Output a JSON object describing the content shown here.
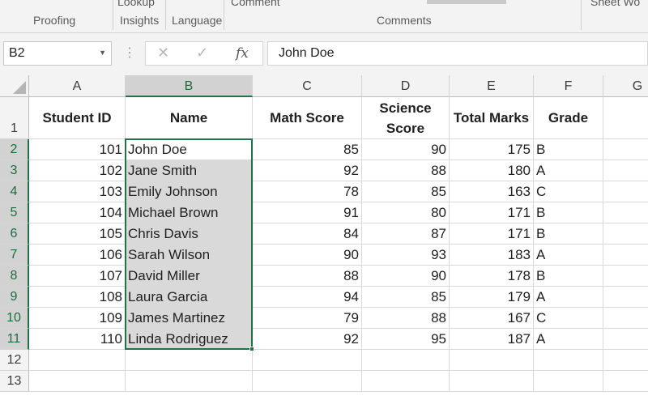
{
  "ribbon": {
    "groups": [
      "Proofing",
      "Insights",
      "Language",
      "Comments"
    ],
    "buttons": [
      "Lookup",
      "Comment",
      "Sheet Wo"
    ]
  },
  "formula_bar": {
    "name_box": "B2",
    "formula": "John Doe",
    "fx_icon": "fx"
  },
  "columns": [
    "A",
    "B",
    "C",
    "D",
    "E",
    "F",
    "G"
  ],
  "rows": [
    "1",
    "2",
    "3",
    "4",
    "5",
    "6",
    "7",
    "8",
    "9",
    "10",
    "11",
    "12",
    "13"
  ],
  "headers": [
    "Student ID",
    "Name",
    "Math Score",
    "Science Score",
    "Total Marks",
    "Grade"
  ],
  "records": [
    [
      "101",
      "John Doe",
      "85",
      "90",
      "175",
      "B"
    ],
    [
      "102",
      "Jane Smith",
      "92",
      "88",
      "180",
      "A"
    ],
    [
      "103",
      "Emily Johnson",
      "78",
      "85",
      "163",
      "C"
    ],
    [
      "104",
      "Michael Brown",
      "91",
      "80",
      "171",
      "B"
    ],
    [
      "105",
      "Chris Davis",
      "84",
      "87",
      "171",
      "B"
    ],
    [
      "106",
      "Sarah Wilson",
      "90",
      "93",
      "183",
      "A"
    ],
    [
      "107",
      "David Miller",
      "88",
      "90",
      "178",
      "B"
    ],
    [
      "108",
      "Laura Garcia",
      "94",
      "85",
      "179",
      "A"
    ],
    [
      "109",
      "James Martinez",
      "79",
      "88",
      "167",
      "C"
    ],
    [
      "110",
      "Linda Rodriguez",
      "92",
      "95",
      "187",
      "A"
    ]
  ],
  "selection": {
    "active_cell": "B2",
    "range": "B2:B11",
    "selected_column": "B",
    "selected_rows": [
      "2",
      "3",
      "4",
      "5",
      "6",
      "7",
      "8",
      "9",
      "10",
      "11"
    ]
  },
  "colors": {
    "accent": "#217346",
    "selection_fill": "#d9d9d9",
    "header_bg": "#f3f3f3"
  }
}
